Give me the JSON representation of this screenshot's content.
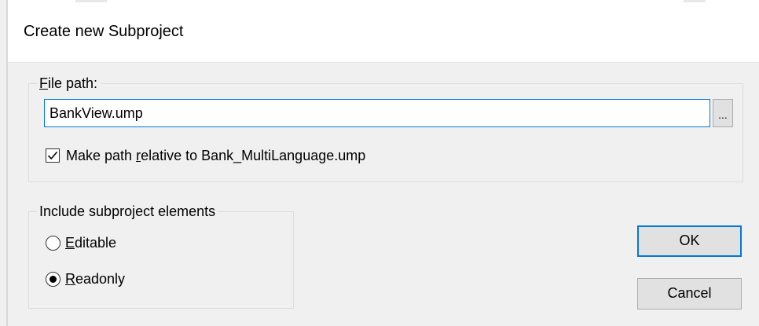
{
  "dialog": {
    "title": "Create new Subproject"
  },
  "file_path_group": {
    "legend_underlined": "F",
    "legend_rest": "ile path:",
    "input_value": "BankView.ump",
    "browse_label": "..."
  },
  "relative_option": {
    "checked": true,
    "label_before": "Make path ",
    "label_underlined": "r",
    "label_after": "elative to Bank_MultiLanguage.ump"
  },
  "include_group": {
    "legend": "Include subproject elements",
    "options": [
      {
        "label_underlined": "E",
        "label_rest": "ditable",
        "selected": false
      },
      {
        "label_underlined": "R",
        "label_rest": "eadonly",
        "selected": true
      }
    ]
  },
  "buttons": {
    "ok_label": "OK",
    "cancel_label": "Cancel"
  },
  "colors": {
    "focus_border": "#0078d7",
    "dialog_bg": "#f0f0f0",
    "title_bg": "#ffffff"
  }
}
